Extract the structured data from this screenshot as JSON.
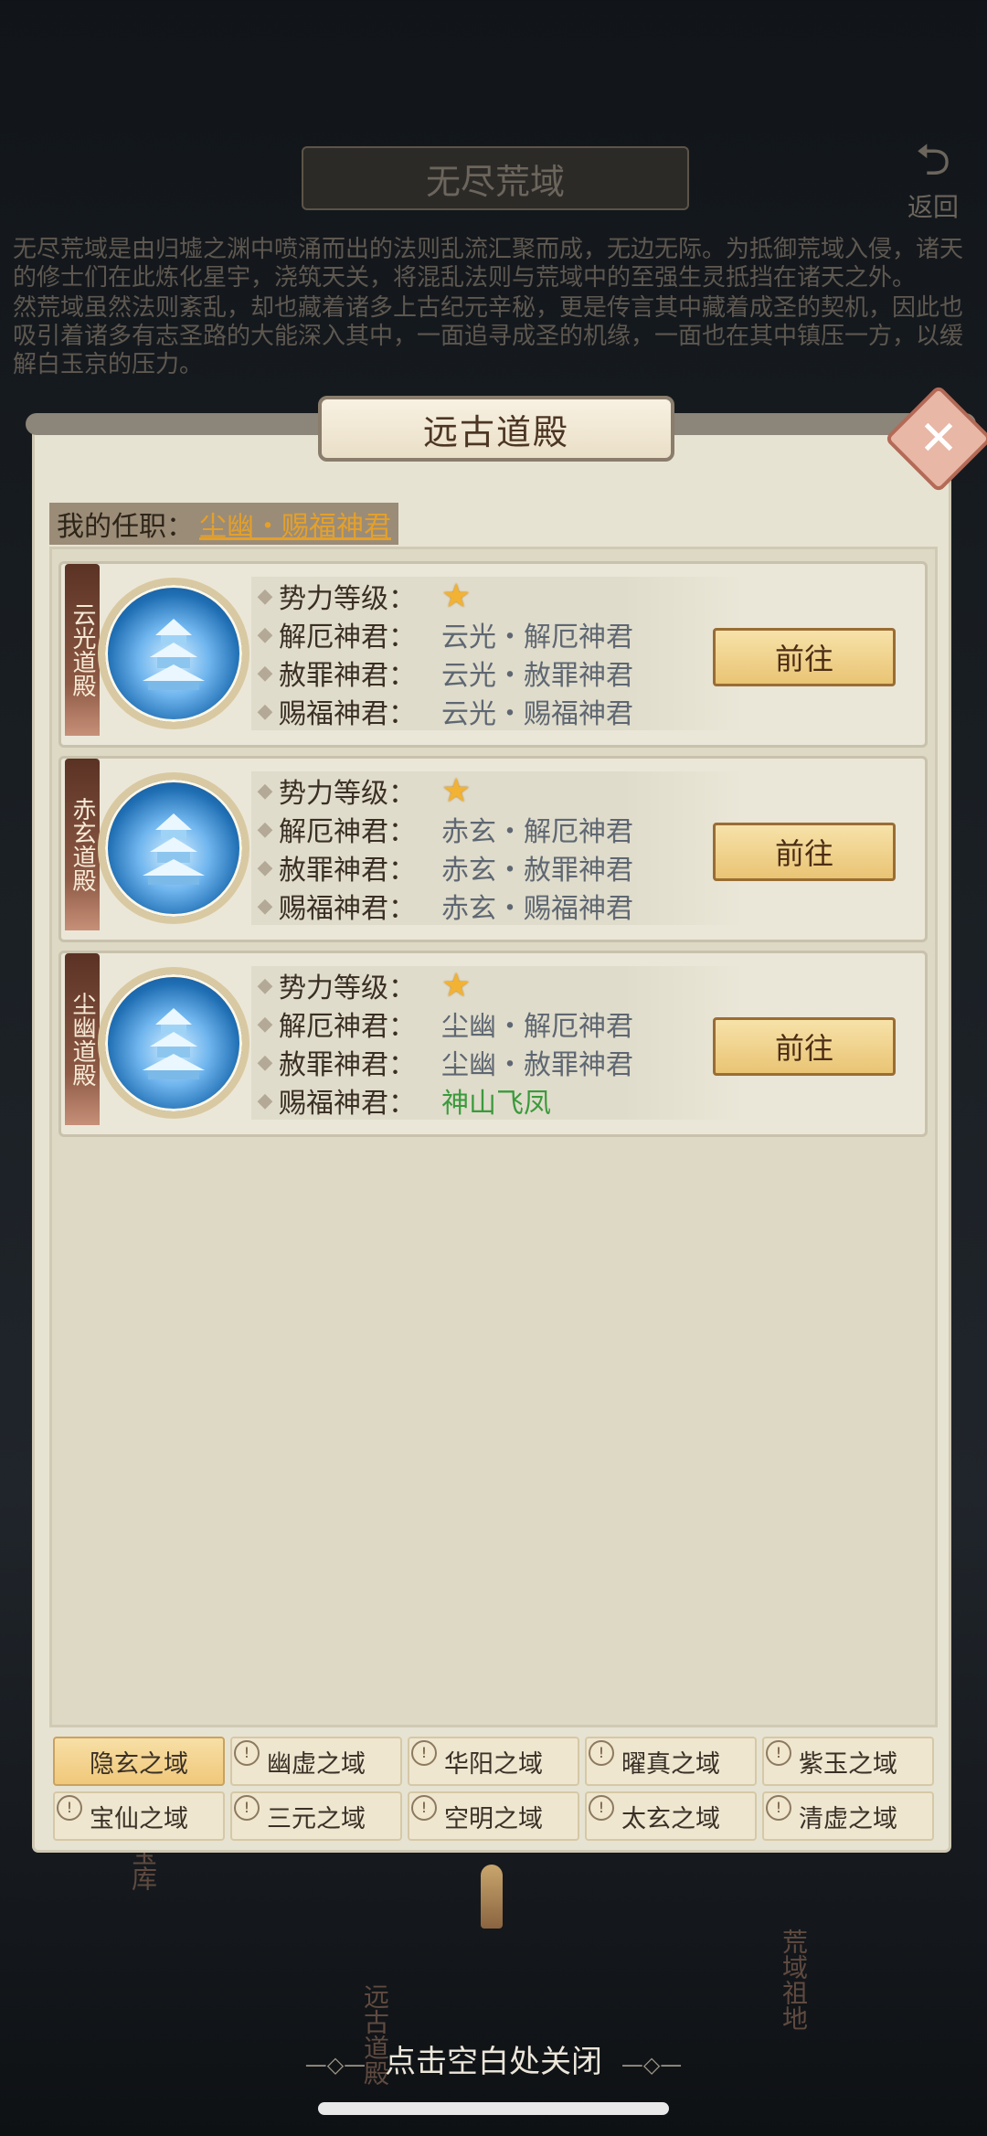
{
  "background": {
    "title": "无尽荒域",
    "back_label": "返回",
    "description": [
      "无尽荒域是由归墟之渊中喷涌而出的法则乱流汇聚而成，无边无际。为抵御荒域入侵，诸天的修士们在此炼化星宇，浇筑天关，将混乱法则与荒域中的至强生灵抵挡在诸天之外。",
      "然荒域虽然法则紊乱，却也藏着诸多上古纪元辛秘，更是传言其中藏着成圣的契机，因此也吸引着诸多有志圣路的大能深入其中，一面追寻成圣的机缘，一面也在其中镇压一方，以缓解白玉京的压力。"
    ],
    "side_labels": [
      "关宝库",
      "远古道殿",
      "荒域祖地"
    ]
  },
  "panel": {
    "title": "远古道殿",
    "close_icon": "close-icon",
    "my_post_label": "我的任职：",
    "my_post_value": "尘幽・赐福神君"
  },
  "palaces": [
    {
      "name": "云光道殿",
      "level_label": "势力等级：",
      "level_stars": 1,
      "rows": [
        {
          "label": "解厄神君：",
          "value": "云光・解厄神君"
        },
        {
          "label": "赦罪神君：",
          "value": "云光・赦罪神君"
        },
        {
          "label": "赐福神君：",
          "value": "云光・赐福神君"
        }
      ],
      "goto": "前往"
    },
    {
      "name": "赤玄道殿",
      "level_label": "势力等级：",
      "level_stars": 1,
      "rows": [
        {
          "label": "解厄神君：",
          "value": "赤玄・解厄神君"
        },
        {
          "label": "赦罪神君：",
          "value": "赤玄・赦罪神君"
        },
        {
          "label": "赐福神君：",
          "value": "赤玄・赐福神君"
        }
      ],
      "goto": "前往"
    },
    {
      "name": "尘幽道殿",
      "level_label": "势力等级：",
      "level_stars": 1,
      "rows": [
        {
          "label": "解厄神君：",
          "value": "尘幽・解厄神君"
        },
        {
          "label": "赦罪神君：",
          "value": "尘幽・赦罪神君"
        },
        {
          "label": "赐福神君：",
          "value": "神山飞凤"
        }
      ],
      "goto": "前往"
    }
  ],
  "tabs": [
    {
      "label": "隐玄之域",
      "active": true,
      "locked": false
    },
    {
      "label": "幽虚之域",
      "active": false,
      "locked": true
    },
    {
      "label": "华阳之域",
      "active": false,
      "locked": true
    },
    {
      "label": "曜真之域",
      "active": false,
      "locked": true
    },
    {
      "label": "紫玉之域",
      "active": false,
      "locked": true
    },
    {
      "label": "宝仙之域",
      "active": false,
      "locked": true
    },
    {
      "label": "三元之域",
      "active": false,
      "locked": true
    },
    {
      "label": "空明之域",
      "active": false,
      "locked": true
    },
    {
      "label": "太玄之域",
      "active": false,
      "locked": true
    },
    {
      "label": "清虚之域",
      "active": false,
      "locked": true
    }
  ],
  "close_hint": "点击空白处关闭",
  "colors": {
    "accent_gold": "#e4a02a",
    "green_value": "#3a9a3c",
    "panel_bg": "#e7e3d3"
  }
}
